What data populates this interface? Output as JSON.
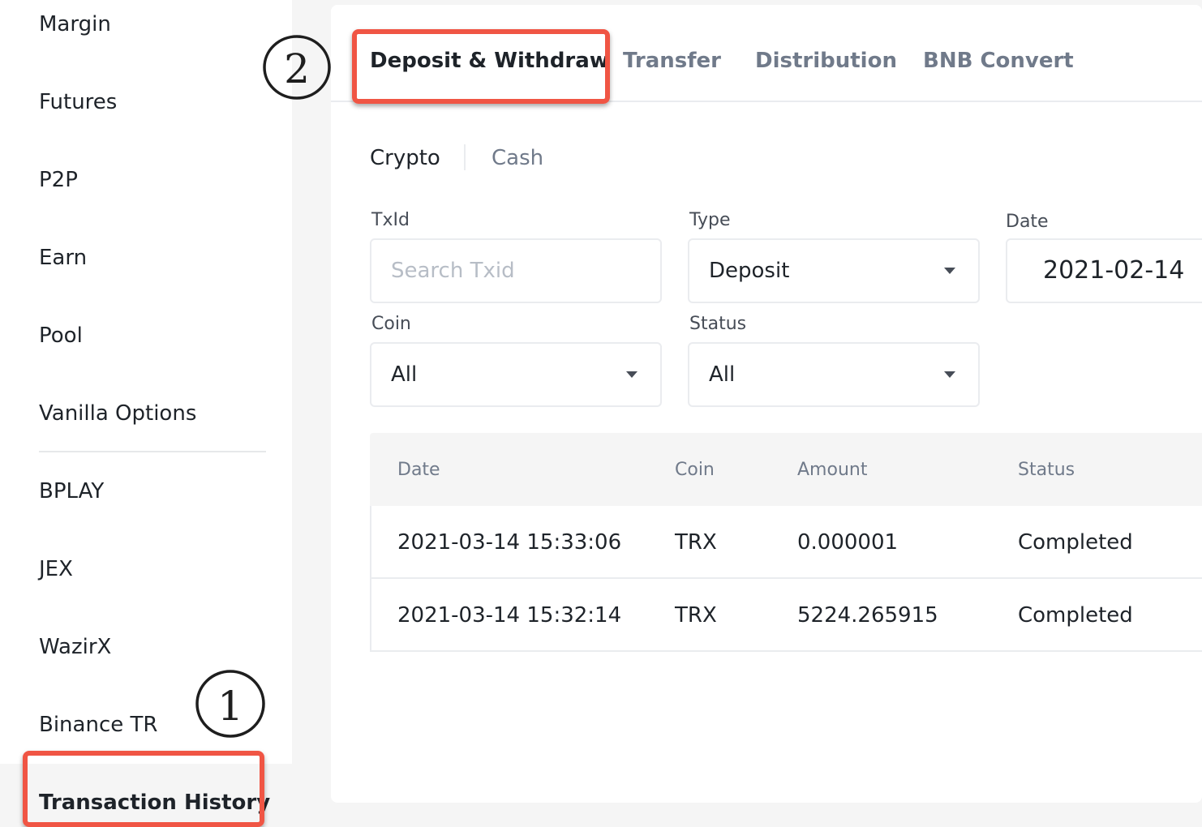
{
  "sidebar": {
    "items": [
      {
        "label": "Margin"
      },
      {
        "label": "Futures"
      },
      {
        "label": "P2P"
      },
      {
        "label": "Earn"
      },
      {
        "label": "Pool"
      },
      {
        "label": "Vanilla Options"
      },
      {
        "label": "BPLAY"
      },
      {
        "label": "JEX"
      },
      {
        "label": "WazirX"
      },
      {
        "label": "Binance TR"
      },
      {
        "label": "Transaction History",
        "active": true
      }
    ]
  },
  "tabs": [
    {
      "label": "Deposit & Withdraw",
      "active": true
    },
    {
      "label": "Transfer"
    },
    {
      "label": "Distribution"
    },
    {
      "label": "BNB Convert"
    }
  ],
  "subtabs": [
    {
      "label": "Crypto",
      "active": true
    },
    {
      "label": "Cash"
    }
  ],
  "filters": {
    "txid": {
      "label": "TxId",
      "placeholder": "Search Txid"
    },
    "type": {
      "label": "Type",
      "value": "Deposit"
    },
    "date": {
      "label": "Date",
      "value": "2021-02-14"
    },
    "coin": {
      "label": "Coin",
      "value": "All"
    },
    "status": {
      "label": "Status",
      "value": "All"
    }
  },
  "table": {
    "columns": [
      "Date",
      "Coin",
      "Amount",
      "Status"
    ],
    "rows": [
      {
        "date": "2021-03-14 15:33:06",
        "coin": "TRX",
        "amount": "0.000001",
        "status": "Completed"
      },
      {
        "date": "2021-03-14 15:32:14",
        "coin": "TRX",
        "amount": "5224.265915",
        "status": "Completed"
      }
    ]
  },
  "annotations": {
    "step1": "1",
    "step2": "2",
    "highlight_color": "#f05544"
  }
}
